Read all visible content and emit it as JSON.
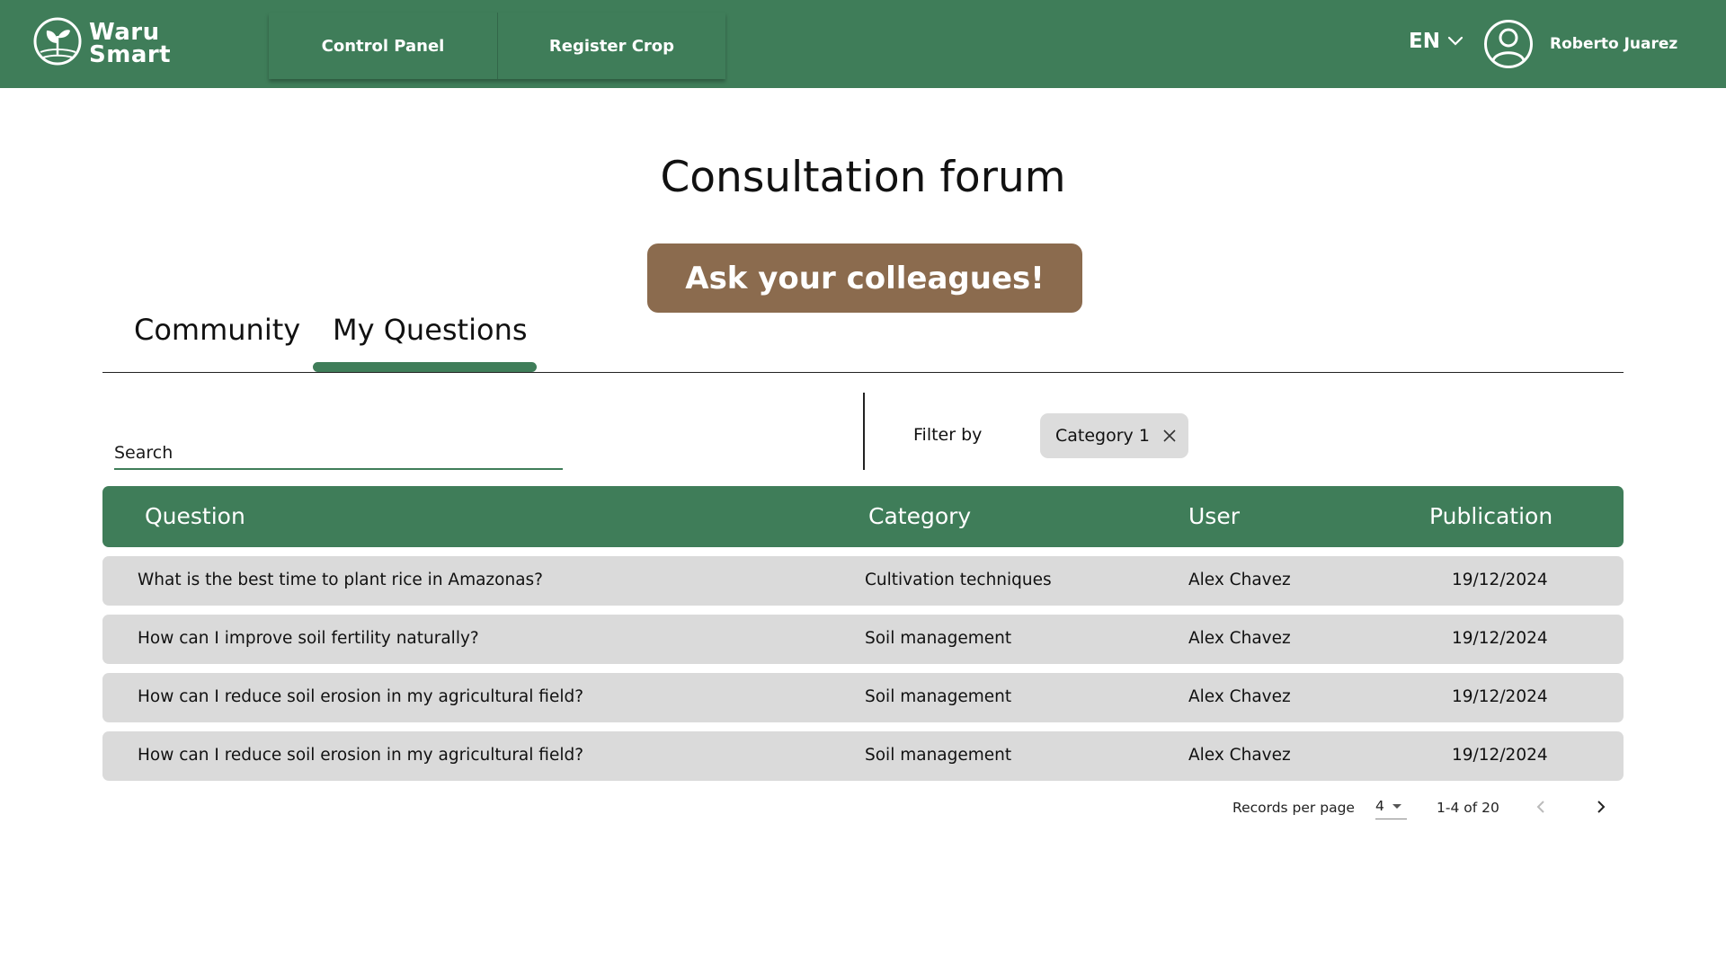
{
  "header": {
    "logo_line1": "Waru",
    "logo_line2": "Smart",
    "nav": [
      {
        "label": "Control Panel"
      },
      {
        "label": "Register Crop"
      }
    ],
    "language": "EN",
    "username": "Roberto Juarez"
  },
  "page": {
    "title": "Consultation forum",
    "cta_label": "Ask your colleagues!"
  },
  "tabs": [
    {
      "label": "Community",
      "active": false
    },
    {
      "label": "My Questions",
      "active": true
    }
  ],
  "search": {
    "placeholder": "Search",
    "value": ""
  },
  "filter": {
    "label": "Filter by",
    "chip_label": "Category 1"
  },
  "table": {
    "headers": {
      "question": "Question",
      "category": "Category",
      "user": "User",
      "publication": "Publication"
    },
    "rows": [
      {
        "question": "What is the best time to plant rice in Amazonas?",
        "category": "Cultivation techniques",
        "user": "Alex Chavez",
        "publication": "19/12/2024"
      },
      {
        "question": "How can I improve soil fertility naturally?",
        "category": "Soil management",
        "user": "Alex Chavez",
        "publication": "19/12/2024"
      },
      {
        "question": "How can I reduce soil erosion in my agricultural field?",
        "category": "Soil management",
        "user": "Alex Chavez",
        "publication": "19/12/2024"
      },
      {
        "question": "How can I reduce soil erosion in my agricultural field?",
        "category": "Soil management",
        "user": "Alex Chavez",
        "publication": "19/12/2024"
      }
    ]
  },
  "pagination": {
    "records_label": "Records per page",
    "per_page": "4",
    "range": "1-4 of 20"
  },
  "colors": {
    "primary": "#3f7d59",
    "accent": "#8b6b4e",
    "row_bg": "#dadada",
    "chip_bg": "#dcdcdc"
  },
  "icons": {
    "logo": "leaf-sprout-icon",
    "language_dropdown": "chevron-down-icon",
    "user": "user-circle-icon",
    "chip_remove": "close-icon",
    "prev_page": "chevron-left-icon",
    "next_page": "chevron-right-icon"
  }
}
